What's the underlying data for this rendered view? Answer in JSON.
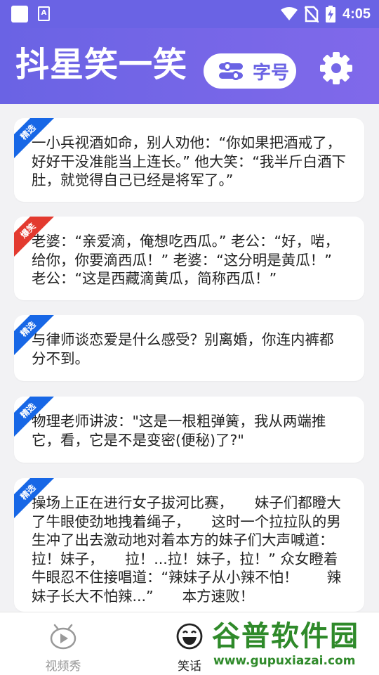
{
  "status_bar": {
    "time": "4:05",
    "a_icon_text": "A"
  },
  "header": {
    "title": "抖星笑一笑",
    "font_size_button_label": "字号"
  },
  "jokes": [
    {
      "tag": "精选",
      "tag_color": "#1767e6",
      "text": "一小兵视酒如命，别人劝他：“你如果把酒戒了，好好干没准能当上连长。” 他大笑：“我半斤白酒下肚，就觉得自己已经是将军了。”"
    },
    {
      "tag": "爆笑",
      "tag_color": "#e33a2f",
      "text": "老婆：“亲爱滴，俺想吃西瓜。” 老公：“好，啱，给你，你要滴西瓜！” 老婆：“这分明是黄瓜！” 老公：“这是西藏滴黄瓜，简称西瓜！”"
    },
    {
      "tag": "精选",
      "tag_color": "#1767e6",
      "text": "与律师谈恋爱是什么感受？别离婚，你连内裤都分不到。"
    },
    {
      "tag": "精选",
      "tag_color": "#1767e6",
      "text": "物理老师讲波：\"这是一根粗弹簧，我从两端推它，看，它是不是变密(便秘)了?\""
    },
    {
      "tag": "精选",
      "tag_color": "#1767e6",
      "text": "操场上正在进行女子拔河比赛，　　妹子们都瞪大了牛眼使劲地拽着绳子，　　这时一个拉拉队的男生冲了出去激动地对着本方的妹子们大声喊道：拉！妹子，　　拉！...拉！妹子，拉！” 众女瞪着牛眼忍不住接唱道：“辣妹子从小辣不怕！　　辣妹子长大不怕辣...”　　本方速败！"
    }
  ],
  "tabs": [
    {
      "label": "视频秀",
      "icon": "video-show-icon",
      "active": false
    },
    {
      "label": "笑话",
      "icon": "smile-face-icon",
      "active": true
    }
  ],
  "watermark": {
    "top_text": "谷普软件园",
    "bottom_text": "www.gupuxiazai.com"
  },
  "colors": {
    "accent": "#6a63e4",
    "tag_blue": "#1767e6",
    "tag_red": "#e33a2f",
    "watermark_green": "#2f8a2a"
  }
}
